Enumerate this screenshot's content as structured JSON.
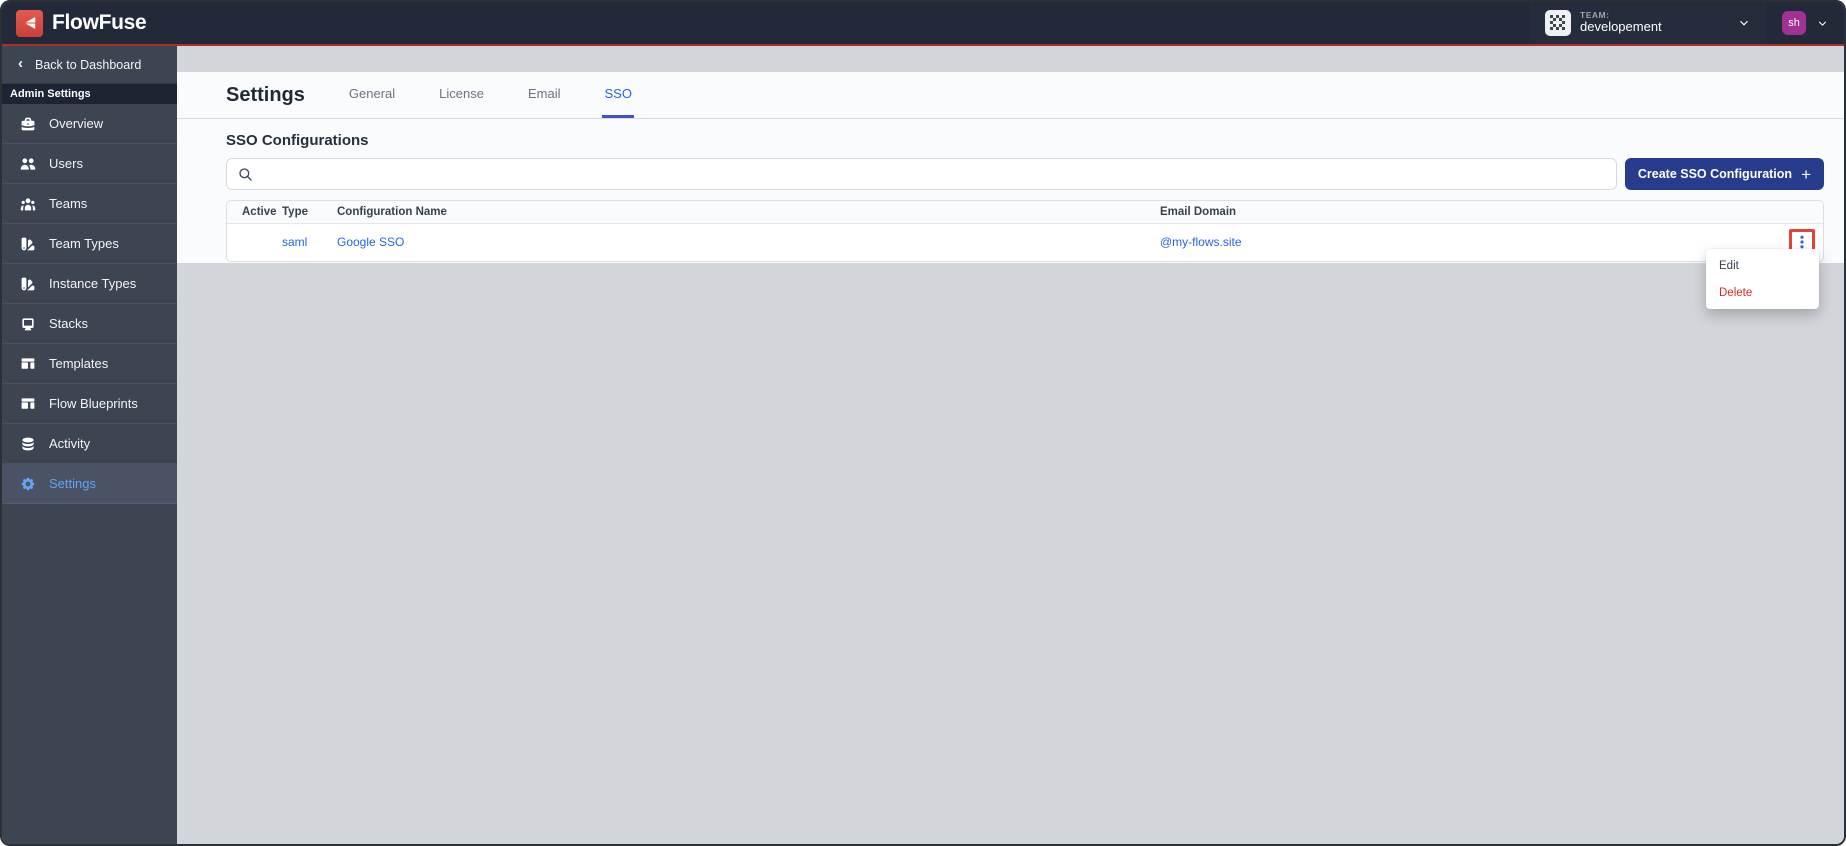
{
  "header": {
    "brand": "FlowFuse",
    "team_label": "TEAM:",
    "team_name": "developement",
    "avatar_initials": "sh"
  },
  "sidebar": {
    "back_label": "Back to Dashboard",
    "section_label": "Admin Settings",
    "items": [
      {
        "label": "Overview",
        "icon": "briefcase-icon",
        "active": false
      },
      {
        "label": "Users",
        "icon": "users-icon",
        "active": false
      },
      {
        "label": "Teams",
        "icon": "user-group-icon",
        "active": false
      },
      {
        "label": "Team Types",
        "icon": "color-swatch-icon",
        "active": false
      },
      {
        "label": "Instance Types",
        "icon": "color-swatch-icon",
        "active": false
      },
      {
        "label": "Stacks",
        "icon": "desktop-icon",
        "active": false
      },
      {
        "label": "Templates",
        "icon": "template-icon",
        "active": false
      },
      {
        "label": "Flow Blueprints",
        "icon": "template-icon",
        "active": false
      },
      {
        "label": "Activity",
        "icon": "database-icon",
        "active": false
      },
      {
        "label": "Settings",
        "icon": "gear-icon",
        "active": true
      }
    ]
  },
  "main": {
    "title": "Settings",
    "tabs": [
      {
        "label": "General",
        "active": false
      },
      {
        "label": "License",
        "active": false
      },
      {
        "label": "Email",
        "active": false
      },
      {
        "label": "SSO",
        "active": true
      }
    ],
    "section_title": "SSO Configurations",
    "search_placeholder": "",
    "create_button_label": "Create SSO Configuration",
    "table": {
      "columns": [
        "Active",
        "Type",
        "Configuration Name",
        "Email Domain"
      ],
      "rows": [
        {
          "active": "",
          "type": "saml",
          "name": "Google SSO",
          "email_domain": "@my-flows.site"
        }
      ]
    },
    "context_menu": {
      "items": [
        {
          "label": "Edit",
          "danger": false
        },
        {
          "label": "Delete",
          "danger": true
        }
      ]
    }
  },
  "colors": {
    "header_bg": "#222938",
    "header_red_line": "#a93128",
    "sidebar_bg": "#3d4452",
    "sidebar_active_text": "#60a5fa",
    "link_blue": "#2563eb",
    "button_bg": "#283c8e",
    "danger_red": "#dc2626",
    "annotation_red": "#e0443a",
    "brand_red": "#d84c44",
    "avatar_purple": "#a03293",
    "page_gray": "#d2d5da"
  }
}
